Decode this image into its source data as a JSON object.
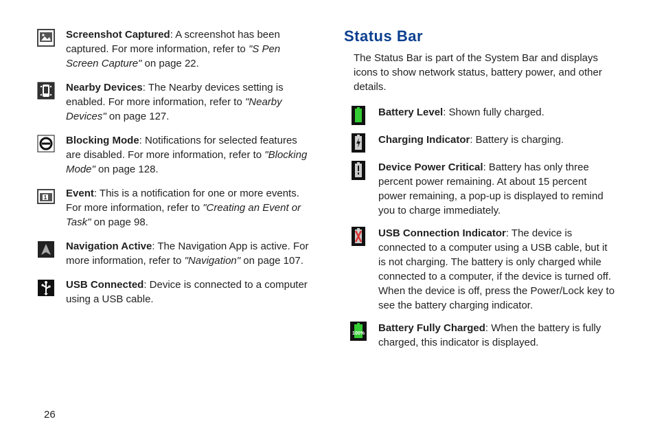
{
  "pageNumber": "26",
  "left": {
    "entries": [
      {
        "term": "Screenshot Captured",
        "desc": ": A screenshot has been captured. For more information, refer to ",
        "ref": "\"S Pen Screen Capture\"",
        "tail": " on page 22."
      },
      {
        "term": "Nearby Devices",
        "desc": ": The Nearby devices setting is enabled. For more information, refer to ",
        "ref": "\"Nearby Devices\"",
        "tail": " on page 127."
      },
      {
        "term": "Blocking Mode",
        "desc": ": Notifications for selected features are disabled. For more information, refer to ",
        "ref": "\"Blocking Mode\"",
        "tail": " on page 128."
      },
      {
        "term": "Event",
        "desc": ": This is a notification for one or more events. For more information, refer to ",
        "ref": "\"Creating an Event or Task\"",
        "tail": " on page 98."
      },
      {
        "term": "Navigation Active",
        "desc": ": The Navigation App is active. For more information, refer to ",
        "ref": "\"Navigation\"",
        "tail": " on page 107."
      },
      {
        "term": "USB Connected",
        "desc": ": Device is connected to a computer using a USB cable.",
        "ref": "",
        "tail": ""
      }
    ]
  },
  "right": {
    "title": "Status Bar",
    "intro": "The Status Bar is part of the System Bar and displays icons to show network status, battery power, and other details.",
    "entries": [
      {
        "term": "Battery Level",
        "desc": ": Shown fully charged.",
        "ref": "",
        "tail": ""
      },
      {
        "term": "Charging Indicator",
        "desc": ": Battery is charging.",
        "ref": "",
        "tail": ""
      },
      {
        "term": "Device Power Critical",
        "desc": ": Battery has only three percent power remaining. At about 15 percent power remaining, a pop-up is displayed to remind you to charge immediately.",
        "ref": "",
        "tail": ""
      },
      {
        "term": "USB Connection Indicator",
        "desc": ": The device is connected to a computer using a USB cable, but it is not charging. The battery is only charged while connected to a computer, if the device is turned off. When the device is off, press the Power/Lock key to see the battery charging indicator.",
        "ref": "",
        "tail": ""
      },
      {
        "term": "Battery Fully Charged",
        "desc": ": When the battery is fully charged, this indicator is displayed.",
        "ref": "",
        "tail": ""
      }
    ]
  }
}
